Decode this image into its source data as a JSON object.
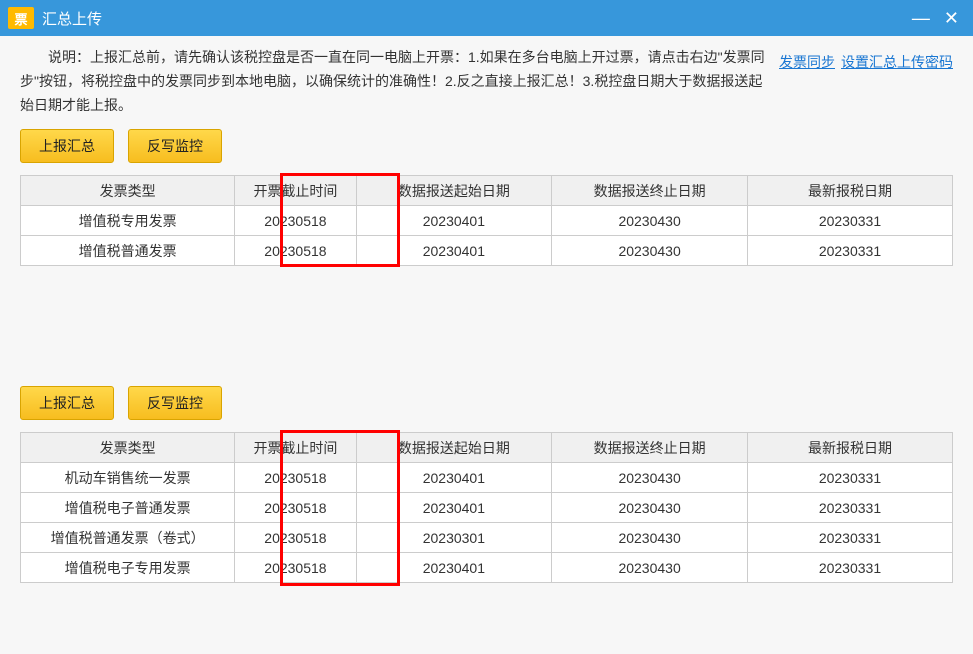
{
  "titlebar": {
    "icon_text": "票",
    "title": "汇总上传"
  },
  "instructions": "说明：上报汇总前，请先确认该税控盘是否一直在同一电脑上开票：1.如果在多台电脑上开过票，请点击右边\"发票同步\"按钮，将税控盘中的发票同步到本地电脑，以确保统计的准确性！2.反之直接上报汇总！3.税控盘日期大于数据报送起始日期才能上报。",
  "links": {
    "sync": "发票同步",
    "set_password": "设置汇总上传密码"
  },
  "buttons": {
    "report_summary": "上报汇总",
    "rewrite_monitor": "反写监控"
  },
  "columns": {
    "c0": "发票类型",
    "c1": "开票截止时间",
    "c2": "数据报送起始日期",
    "c3": "数据报送终止日期",
    "c4": "最新报税日期"
  },
  "table1": [
    {
      "type": "增值税专用发票",
      "deadline": "20230518",
      "start": "20230401",
      "end": "20230430",
      "latest": "20230331"
    },
    {
      "type": "增值税普通发票",
      "deadline": "20230518",
      "start": "20230401",
      "end": "20230430",
      "latest": "20230331"
    }
  ],
  "table2": [
    {
      "type": "机动车销售统一发票",
      "deadline": "20230518",
      "start": "20230401",
      "end": "20230430",
      "latest": "20230331"
    },
    {
      "type": "增值税电子普通发票",
      "deadline": "20230518",
      "start": "20230401",
      "end": "20230430",
      "latest": "20230331"
    },
    {
      "type": "增值税普通发票（卷式）",
      "deadline": "20230518",
      "start": "20230301",
      "end": "20230430",
      "latest": "20230331"
    },
    {
      "type": "增值税电子专用发票",
      "deadline": "20230518",
      "start": "20230401",
      "end": "20230430",
      "latest": "20230331"
    }
  ]
}
